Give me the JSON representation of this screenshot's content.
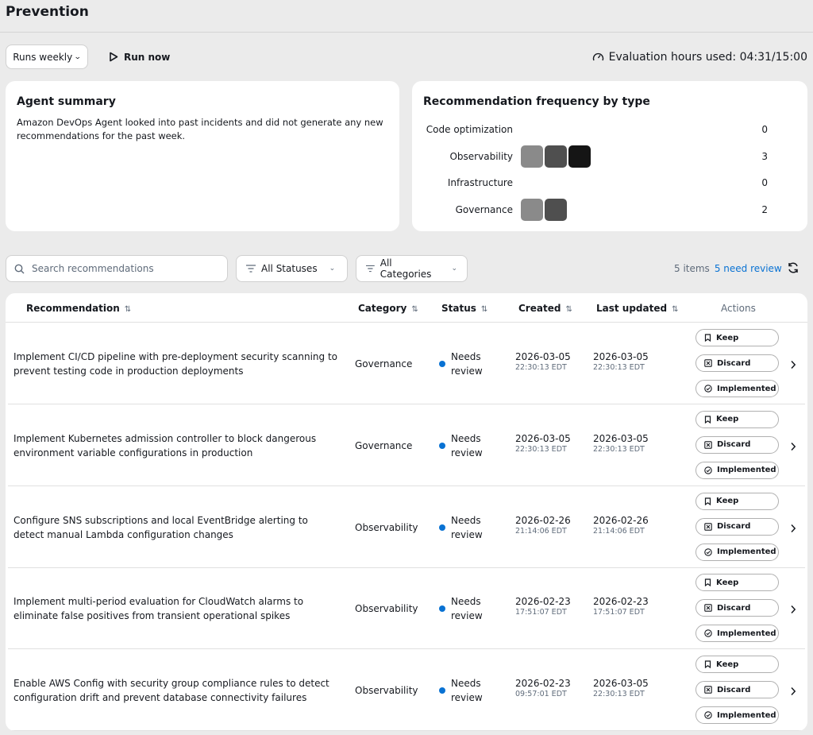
{
  "header": {
    "title": "Prevention",
    "runs_label": "Runs weekly",
    "run_now_label": "Run now",
    "evaluation_label": "Evaluation hours used: 04:31/15:00"
  },
  "summary": {
    "title": "Agent summary",
    "text": "Amazon DevOps Agent looked into past incidents and did not generate any new recommendations for the past week."
  },
  "frequency": {
    "title": "Recommendation frequency by type",
    "bar_colors": [
      "#8a8a8a",
      "#4f4f4f",
      "#151515"
    ],
    "rows": [
      {
        "label": "Code optimization",
        "count": "0",
        "value": 0
      },
      {
        "label": "Observability",
        "count": "3",
        "value": 3
      },
      {
        "label": "Infrastructure",
        "count": "0",
        "value": 0
      },
      {
        "label": "Governance",
        "count": "2",
        "value": 2
      }
    ]
  },
  "toolbar": {
    "search_placeholder": "Search recommendations",
    "status_filter": "All Statuses",
    "category_filter": "All Categories",
    "items_count": "5 items",
    "need_review": "5 need review"
  },
  "table": {
    "headers": {
      "recommendation": "Recommendation",
      "category": "Category",
      "status": "Status",
      "created": "Created",
      "last_updated": "Last updated",
      "actions": "Actions"
    },
    "action_labels": {
      "keep": "Keep",
      "discard": "Discard",
      "implemented": "Implemented"
    },
    "status_color": "#0972d3",
    "rows": [
      {
        "recommendation": "Implement CI/CD pipeline with pre-deployment security scanning to prevent testing code in production deployments",
        "category": "Governance",
        "status": "Needs review",
        "created_date": "2026-03-05",
        "created_time": "22:30:13 EDT",
        "updated_date": "2026-03-05",
        "updated_time": "22:30:13 EDT"
      },
      {
        "recommendation": "Implement Kubernetes admission controller to block dangerous environment variable configurations in production",
        "category": "Governance",
        "status": "Needs review",
        "created_date": "2026-03-05",
        "created_time": "22:30:13 EDT",
        "updated_date": "2026-03-05",
        "updated_time": "22:30:13 EDT"
      },
      {
        "recommendation": "Configure SNS subscriptions and local EventBridge alerting to detect manual Lambda configuration changes",
        "category": "Observability",
        "status": "Needs review",
        "created_date": "2026-02-26",
        "created_time": "21:14:06 EDT",
        "updated_date": "2026-02-26",
        "updated_time": "21:14:06 EDT"
      },
      {
        "recommendation": "Implement multi-period evaluation for CloudWatch alarms to eliminate false positives from transient operational spikes",
        "category": "Observability",
        "status": "Needs review",
        "created_date": "2026-02-23",
        "created_time": "17:51:07 EDT",
        "updated_date": "2026-02-23",
        "updated_time": "17:51:07 EDT"
      },
      {
        "recommendation": "Enable AWS Config with security group compliance rules to detect configuration drift and prevent database connectivity failures",
        "category": "Observability",
        "status": "Needs review",
        "created_date": "2026-02-23",
        "created_time": "09:57:01 EDT",
        "updated_date": "2026-03-05",
        "updated_time": "22:30:13 EDT"
      }
    ]
  }
}
